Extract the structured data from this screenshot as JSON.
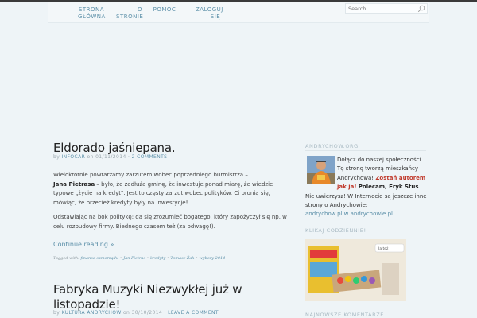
{
  "nav": {
    "items": [
      {
        "label_line1": "Strona",
        "label_line2": "główna"
      },
      {
        "label_line1": "O",
        "label_line2": "stronie"
      },
      {
        "label_line1": "Pomoc",
        "label_line2": ""
      },
      {
        "label_line1": "Zaloguj",
        "label_line2": "się"
      }
    ]
  },
  "search": {
    "placeholder": "Search"
  },
  "posts": [
    {
      "title": "Eldorado jaśniepana.",
      "meta_by": "by",
      "author": "INFOCAR",
      "meta_on": "on",
      "date": "01/11/2014",
      "meta_sep": "·",
      "comments": "2 COMMENTS",
      "para1_a": "Wielokrotnie powtarzamy zarzutem wobec poprzedniego burmistrza –",
      "para1_bold": "Jana Pietrasa",
      "para1_b": " – było, że zadłuża gminę, że inwestuje ponad miarę, że wiedzie typowe „życie na kredyt\". Jest to częsty zarzut wobec polityków. Ci bronią się, mówiąc, że przecież kredyty były na inwestycje!",
      "para2": "Odstawiając na bok politykę: da się zrozumieć bogatego, który zapożyczył się np. w celu rozbudowy firmy. Biednego czasem też (za odwagę!).",
      "continue": "Continue reading »",
      "tags_label": "Tagged with:",
      "tags": [
        "finanse samorządu",
        "Jan Pietras",
        "kredyty",
        "Tomasz Żak",
        "wybory 2014"
      ],
      "tag_sep": "•"
    },
    {
      "title": "Fabryka Muzyki Niezwykłej już w listopadzie!",
      "meta_by": "by",
      "author": "KULTURA ANDRYCHOW",
      "meta_on": "on",
      "date": "30/10/2014",
      "meta_sep": "·",
      "comments": "LEAVE A COMMENT"
    }
  ],
  "sidebar": {
    "widget1_title": "ANDRYCHOW.ORG",
    "widget1_line1": "Dołącz do naszej społeczności.",
    "widget1_line2": "Tę stronę tworzą mieszkańcy",
    "widget1_line3a": "Andrychowa!",
    "widget1_line3b": "Zostań autorem",
    "widget1_line4a": "jak ja!",
    "widget1_line4b": "Polecam, Eryk Stus",
    "widget1_line5": "Nie uwierzysz! W Internecie są jeszcze inne strony o Andrychowie:",
    "widget1_link": "andrychow.pl w andrychowie.pl",
    "widget2_title": "KLIKAJ CODZIENNIE!",
    "widget3_title": "NAJNOWSZE KOMENTARZE",
    "promo_text": "Ja też",
    "accent": "#5b8fa8"
  }
}
